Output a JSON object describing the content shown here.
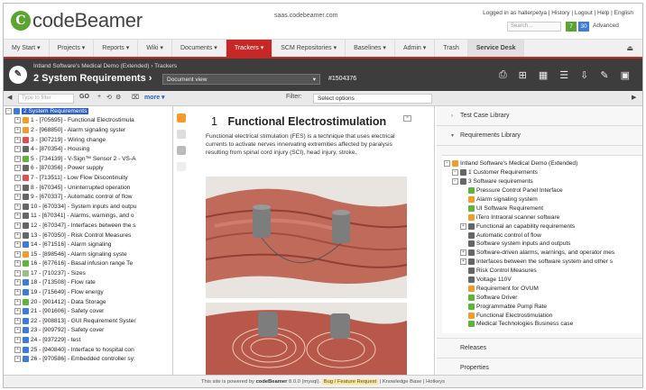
{
  "header": {
    "logo_letter": "C",
    "logo_text": "codeBeamer",
    "host": "saas.codebeamer.com",
    "user_line": "Logged in as hallerpetya | History | Logout | Help | English",
    "search_placeholder": "Search...",
    "badge_a": "7",
    "badge_b": "30",
    "advanced_label": "Advanced"
  },
  "nav": {
    "items": [
      "My Start ▾",
      "Projects ▾",
      "Reports ▾",
      "Wiki ▾",
      "Documents ▾",
      "Trackers ▾",
      "SCM Repositories ▾",
      "Baselines ▾",
      "Admin ▾",
      "Trash",
      "Service Desk"
    ]
  },
  "titlebar": {
    "crumb": "Intland Software's Medical Demo (Extended) › Trackers",
    "title": "2 System Requirements ›",
    "view_select": "Document view",
    "item_id": "#1504376"
  },
  "toolbar": {
    "filter_placeholder": "Type to filter",
    "go_label": "GO",
    "more_label": "more ▾",
    "filter_label": "Filter:",
    "select_options": "Select options"
  },
  "tree": {
    "root": "2 System Requirements",
    "items": [
      {
        "label": "1 - [705695] - Functional Electrostimula",
        "icon": "orange"
      },
      {
        "label": "2 - [968850] - Alarm signaling syster",
        "icon": "orange"
      },
      {
        "label": "3 - [307219] - Wiring change",
        "icon": "red"
      },
      {
        "label": "4 - [870354] - Housing",
        "icon": "grey"
      },
      {
        "label": "5 - [734139] - V-Sign™ Sensor 2 - VS-A",
        "icon": "green"
      },
      {
        "label": "6 - [870356] - Power supply",
        "icon": "grey"
      },
      {
        "label": "7 - [713511] - Low Flow Discontinuity",
        "icon": "red"
      },
      {
        "label": "8 - [670345] - Uninterrupted operation",
        "icon": "grey"
      },
      {
        "label": "9 - [670337] - Automatic control of flow",
        "icon": "grey"
      },
      {
        "label": "10 - [670334] - System inputs and outpu",
        "icon": "grey"
      },
      {
        "label": "11 - [670341] - Alarms, warnings, and o",
        "icon": "grey"
      },
      {
        "label": "12 - [670347] - Interfaces between the s",
        "icon": "grey"
      },
      {
        "label": "13 - [670350] - Risk Control Measures",
        "icon": "grey"
      },
      {
        "label": "14 - [671516] - Alarm signaling",
        "icon": "blue"
      },
      {
        "label": "15 - [898546] - Alarm signaling syste",
        "icon": "orange"
      },
      {
        "label": "16 - [677616] - Basal infusion range Te",
        "icon": "green"
      },
      {
        "label": "17 - [710237] - Sizes",
        "icon": "light"
      },
      {
        "label": "18 - [713508] - Flow rate",
        "icon": "blue"
      },
      {
        "label": "19 - [715649] - Flow energy",
        "icon": "blue"
      },
      {
        "label": "20 - [901412] - Data Storage",
        "icon": "green"
      },
      {
        "label": "21 - [901606] - Safety cover",
        "icon": "blue"
      },
      {
        "label": "22 - [908813] - GUI Requirement Syster",
        "icon": "blue"
      },
      {
        "label": "23 - [909792] - Safety cover",
        "icon": "blue"
      },
      {
        "label": "24 - [937229] - test",
        "icon": "blue"
      },
      {
        "label": "25 - [940840] - Interface to hospital con",
        "icon": "blue"
      },
      {
        "label": "26 - [970586] - Embedded controller sy:",
        "icon": "blue"
      }
    ]
  },
  "document": {
    "number": "1",
    "heading": "Functional Electrostimulation",
    "body": "Functional electrical stimulation (FES) is a technique that uses electrical currents to activate nerves innervating extremities affected by paralysis resulting from spinal cord injury (SCI), head injury, stroke."
  },
  "right_panel": {
    "section1": "Test Case Library",
    "section2": "Requirements Library",
    "tree": [
      {
        "label": "Intland Software's Medical Demo (Extended)",
        "indent": 0,
        "icon": "orange"
      },
      {
        "label": "1 Customer Requirements",
        "indent": 1,
        "icon": "grey"
      },
      {
        "label": "3 Software requirements",
        "indent": 1,
        "icon": "grey"
      },
      {
        "label": "Pressure Control Panel Interface",
        "indent": 2,
        "icon": "green"
      },
      {
        "label": "Alarm signaling system",
        "indent": 2,
        "icon": "orange"
      },
      {
        "label": "UI Software Requirement",
        "indent": 2,
        "icon": "green"
      },
      {
        "label": "iTero Intraoral scanner software",
        "indent": 2,
        "icon": "orange"
      },
      {
        "label": "Functional an capability requirements",
        "indent": 2,
        "icon": "grey"
      },
      {
        "label": "Automatic control of flow",
        "indent": 2,
        "icon": "grey"
      },
      {
        "label": "Software system inputs and outputs",
        "indent": 2,
        "icon": "grey"
      },
      {
        "label": "Software-driven alarms, warnings, and operator mes",
        "indent": 2,
        "icon": "grey"
      },
      {
        "label": "Interfaces between the software system and other s",
        "indent": 2,
        "icon": "grey"
      },
      {
        "label": "Risk Control Measures",
        "indent": 2,
        "icon": "grey"
      },
      {
        "label": "Voltage 110V",
        "indent": 2,
        "icon": "grey"
      },
      {
        "label": "Requirement for OVUM",
        "indent": 2,
        "icon": "orange"
      },
      {
        "label": "Software Driver",
        "indent": 2,
        "icon": "green"
      },
      {
        "label": "Programmable Pump Rate",
        "indent": 2,
        "icon": "green"
      },
      {
        "label": "Functional Electrostimulation",
        "indent": 2,
        "icon": "orange"
      },
      {
        "label": "Medical Technologies Business case",
        "indent": 2,
        "icon": "green"
      }
    ],
    "section3": "Releases",
    "section4": "Properties"
  },
  "footer": {
    "text_a": "This site is powered by",
    "brand": "codeBeamer",
    "text_b": "8.0.0 (mysql).",
    "bug": "Bug / Feature Request",
    "text_c": "| Knowledge Base |",
    "hotkeys": "Hotkeys"
  },
  "colors": {
    "accent": "#c62828",
    "titlebar": "#3d3d3d",
    "logo_green": "#5aa52f",
    "selection": "#2a62c8"
  }
}
